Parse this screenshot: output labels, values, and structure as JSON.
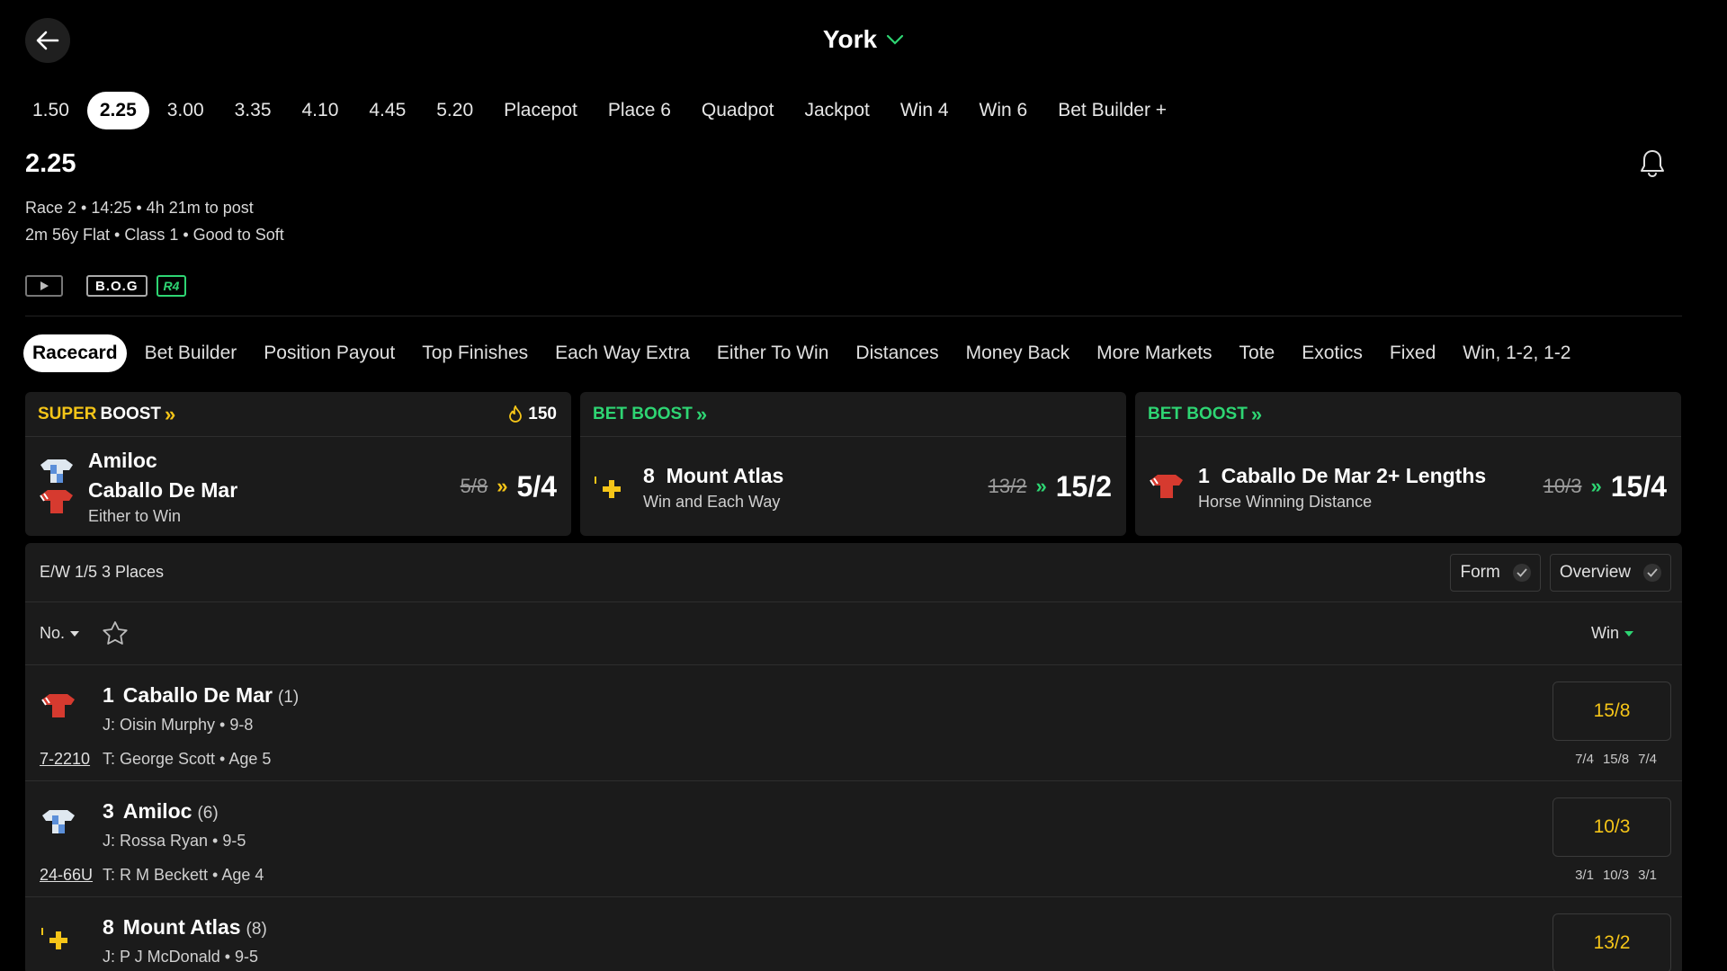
{
  "header": {
    "venue": "York",
    "race_times": [
      {
        "label": "1.50",
        "active": false
      },
      {
        "label": "2.25",
        "active": true
      },
      {
        "label": "3.00",
        "active": false
      },
      {
        "label": "3.35",
        "active": false
      },
      {
        "label": "4.10",
        "active": false
      },
      {
        "label": "4.45",
        "active": false
      },
      {
        "label": "5.20",
        "active": false
      },
      {
        "label": "Placepot",
        "active": false
      },
      {
        "label": "Place 6",
        "active": false
      },
      {
        "label": "Quadpot",
        "active": false
      },
      {
        "label": "Jackpot",
        "active": false
      },
      {
        "label": "Win 4",
        "active": false
      },
      {
        "label": "Win 6",
        "active": false
      },
      {
        "label": "Bet Builder +",
        "active": false
      }
    ]
  },
  "race": {
    "title": "2.25",
    "meta_line1": "Race 2 • 14:25 • 4h 21m to post",
    "meta_line2": "2m 56y Flat  • Class 1  • Good to Soft",
    "badge_bog": "B.O.G",
    "badge_r4": "R4"
  },
  "tabs": [
    {
      "label": "Racecard",
      "active": true
    },
    {
      "label": "Bet Builder",
      "active": false
    },
    {
      "label": "Position Payout",
      "active": false
    },
    {
      "label": "Top Finishes",
      "active": false
    },
    {
      "label": "Each Way Extra",
      "active": false
    },
    {
      "label": "Either To Win",
      "active": false
    },
    {
      "label": "Distances",
      "active": false
    },
    {
      "label": "Money Back",
      "active": false
    },
    {
      "label": "More Markets",
      "active": false
    },
    {
      "label": "Tote",
      "active": false
    },
    {
      "label": "Exotics",
      "active": false
    },
    {
      "label": "Fixed",
      "active": false
    },
    {
      "label": "Win, 1-2, 1-2",
      "active": false
    }
  ],
  "boosts": [
    {
      "label_a": "SUPER",
      "label_b": "BOOST",
      "fire_count": "150",
      "selection_lines": [
        "Amiloc",
        "Caballo De Mar"
      ],
      "market": "Either to Win",
      "old_odds": "5/8",
      "new_odds": "5/4"
    },
    {
      "label_a": "BET BOOST",
      "number": "8",
      "selection": "Mount Atlas",
      "market": "Win and Each Way",
      "old_odds": "13/2",
      "new_odds": "15/2"
    },
    {
      "label_a": "BET BOOST",
      "number": "1",
      "selection": "Caballo De Mar 2+ Lengths",
      "market": "Horse Winning Distance",
      "old_odds": "10/3",
      "new_odds": "15/4"
    }
  ],
  "racecard": {
    "ew_terms": "E/W 1/5 3 Places",
    "toggle_form": "Form",
    "toggle_overview": "Overview",
    "sort_label": "No.",
    "price_header": "Win",
    "runners": [
      {
        "number": "1",
        "name": "Caballo De Mar",
        "draw": "(1)",
        "jockey": "J: Oisin Murphy • 9-8",
        "form": "7-2210",
        "trainer": "T: George Scott • Age 5",
        "price": "15/8",
        "history": [
          "7/4",
          "15/8",
          "7/4"
        ],
        "silk": "red"
      },
      {
        "number": "3",
        "name": "Amiloc",
        "draw": "(6)",
        "jockey": "J: Rossa Ryan • 9-5",
        "form": "24-66U",
        "trainer": "T: R M Beckett • Age 4",
        "price": "10/3",
        "history": [
          "3/1",
          "10/3",
          "3/1"
        ],
        "silk": "blue"
      },
      {
        "number": "8",
        "name": "Mount Atlas",
        "draw": "(8)",
        "jockey": "J: P J McDonald • 9-5",
        "form": "",
        "trainer": "",
        "price": "13/2",
        "history": [],
        "silk": "yellow"
      }
    ]
  },
  "colors": {
    "accent_green": "#2ed573",
    "accent_yellow": "#f5c518",
    "background": "#000000",
    "card": "#1b1b1b"
  }
}
